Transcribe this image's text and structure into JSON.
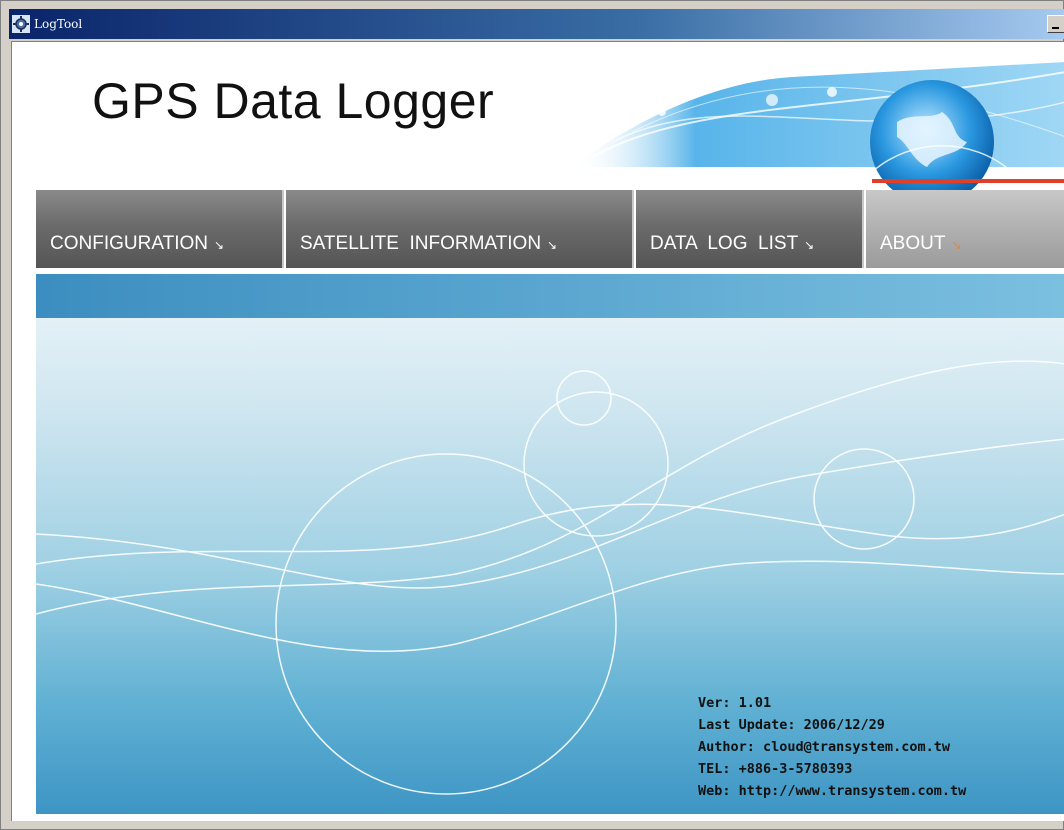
{
  "window": {
    "title": "LogTool",
    "app_icon": "gear-app-icon"
  },
  "header": {
    "title": "GPS Data Logger"
  },
  "nav": {
    "items": [
      {
        "label": "CONFIGURATION",
        "arrow": "↘"
      },
      {
        "label": "SATELLITE  INFORMATION",
        "arrow": "↘"
      },
      {
        "label": "DATA  LOG  LIST",
        "arrow": "↘"
      },
      {
        "label": "ABOUT",
        "arrow": "↘"
      }
    ],
    "active": "ABOUT"
  },
  "about": {
    "version": "Ver: 1.01",
    "last_update": "Last Update: 2006/12/29",
    "author": "Author: cloud@transystem.com.tw",
    "tel": "TEL: +886-3-5780393",
    "web": "Web: http://www.transystem.com.tw"
  },
  "colors": {
    "titlebar": "#0a246a",
    "nav": "#6b6b6b",
    "nav_active": "#b0b0b0",
    "accent_line": "#e0402a",
    "content": "#5fb0d3"
  }
}
